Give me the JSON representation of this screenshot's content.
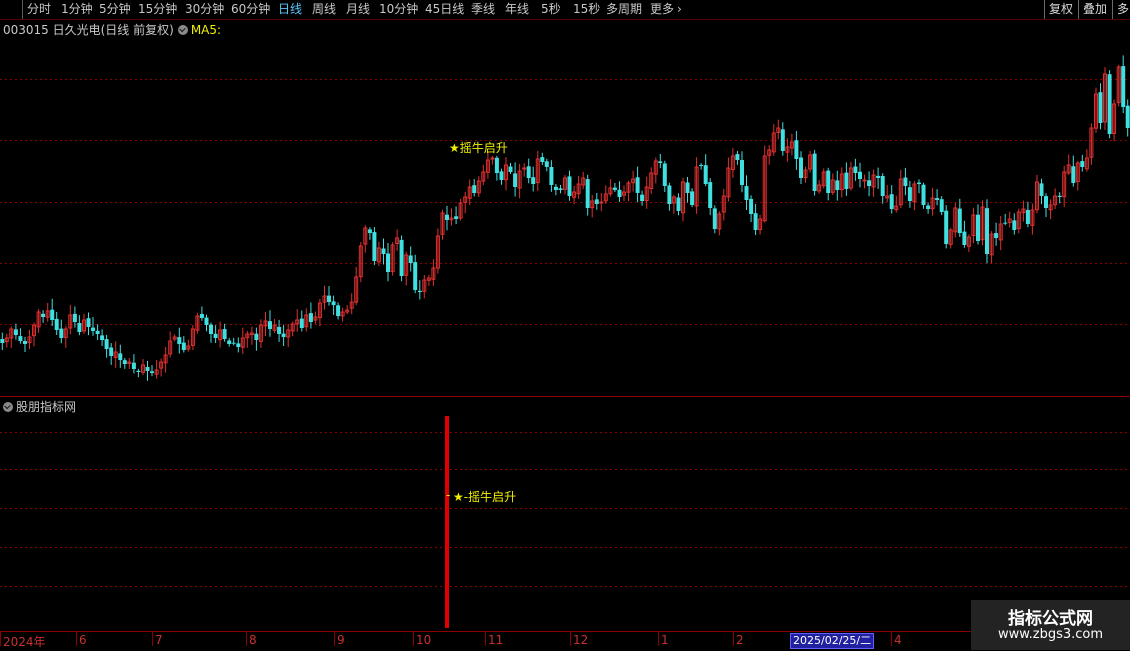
{
  "toolbar": {
    "periods": [
      "分时",
      "1分钟",
      "5分钟",
      "15分钟",
      "30分钟",
      "60分钟",
      "日线",
      "周线",
      "月线",
      "10分钟",
      "45日线",
      "季线",
      "年线",
      "5秒",
      "15秒",
      "多周期",
      "更多"
    ],
    "active_period": "日线",
    "more_arrow": "›",
    "right_buttons": [
      "复权",
      "叠加",
      "多"
    ]
  },
  "header": {
    "stock": "003015 日久光电(日线 前复权)",
    "ma_label": "MA5:"
  },
  "indicator": {
    "title": "股朋指标网",
    "signal_label": "★-摇牛启升",
    "signal_prefix": "-"
  },
  "main_signal": {
    "label": "★摇牛启升"
  },
  "axis": {
    "dates": [
      "2024年",
      "6",
      "7",
      "8",
      "9",
      "10",
      "11",
      "12",
      "1",
      "2",
      "2025/02/25/二",
      "4"
    ]
  },
  "watermark": {
    "title": "指标公式网",
    "url": "www.zbgs3.com"
  },
  "colors": {
    "up": "#e03030",
    "down": "#40e0e0",
    "grid": "#8a0000",
    "signal_bar": "#e00000",
    "yellow": "#f0f000",
    "active_tab": "#56c8ff"
  },
  "chart_data": {
    "type": "candlestick",
    "closes": [
      343,
      338,
      329,
      335,
      341,
      344,
      337,
      325,
      312,
      317,
      311,
      320,
      330,
      338,
      329,
      315,
      322,
      332,
      320,
      327,
      331,
      334,
      340,
      349,
      356,
      352,
      360,
      364,
      362,
      369,
      372,
      365,
      371,
      373,
      370,
      362,
      355,
      341,
      337,
      344,
      350,
      346,
      329,
      316,
      318,
      325,
      334,
      338,
      330,
      339,
      344,
      343,
      347,
      338,
      334,
      333,
      340,
      325,
      321,
      329,
      325,
      334,
      337,
      330,
      324,
      320,
      328,
      315,
      322,
      317,
      303,
      296,
      302,
      305,
      316,
      312,
      310,
      302,
      277,
      246,
      228,
      233,
      261,
      248,
      254,
      272,
      245,
      238,
      276,
      255,
      263,
      290,
      292,
      280,
      278,
      268,
      236,
      213,
      220,
      218,
      219,
      203,
      197,
      187,
      193,
      181,
      172,
      160,
      158,
      173,
      180,
      165,
      172,
      187,
      171,
      168,
      178,
      184,
      159,
      162,
      167,
      185,
      190,
      190,
      178,
      196,
      192,
      184,
      178,
      208,
      201,
      204,
      202,
      194,
      188,
      190,
      197,
      192,
      183,
      179,
      193,
      201,
      187,
      173,
      161,
      163,
      186,
      204,
      197,
      211,
      182,
      193,
      205,
      167,
      166,
      184,
      208,
      229,
      214,
      196,
      168,
      156,
      160,
      185,
      200,
      214,
      230,
      219,
      156,
      150,
      133,
      128,
      151,
      147,
      142,
      159,
      178,
      170,
      155,
      191,
      185,
      172,
      193,
      180,
      190,
      174,
      189,
      168,
      173,
      179,
      180,
      186,
      175,
      178,
      196,
      196,
      209,
      206,
      179,
      186,
      201,
      184,
      184,
      205,
      209,
      198,
      200,
      212,
      244,
      230,
      208,
      233,
      245,
      237,
      215,
      241,
      207,
      254,
      234,
      238,
      224,
      223,
      219,
      230,
      212,
      209,
      224,
      210,
      182,
      196,
      208,
      205,
      196,
      197,
      172,
      165,
      183,
      163,
      167,
      158,
      128,
      94,
      123,
      74,
      134,
      104,
      67,
      107,
      128
    ]
  }
}
